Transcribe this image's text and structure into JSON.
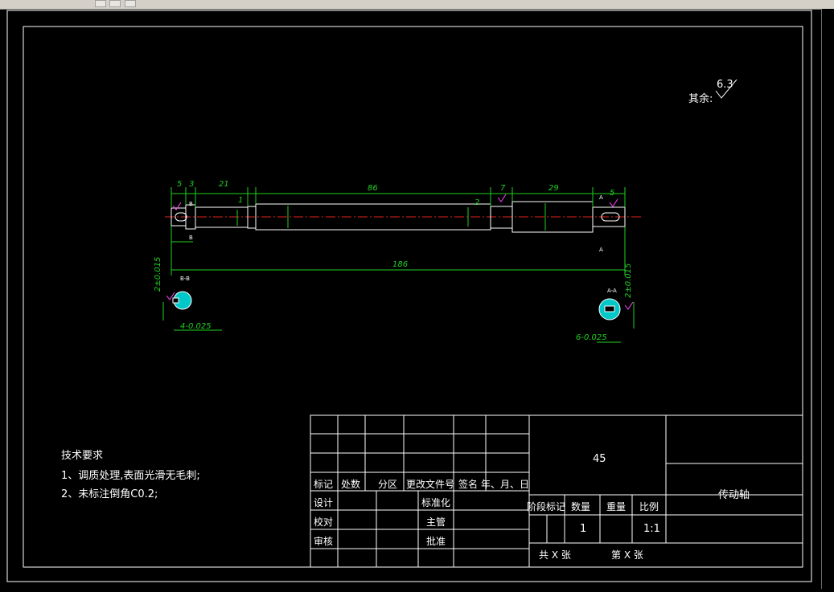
{
  "drawing": {
    "surface_roughness": {
      "label": "其余:",
      "value": "6.3"
    },
    "tech_requirements": {
      "title": "技术要求",
      "items": [
        "1、调质处理,表面光滑无毛刺;",
        "2、未标注倒角C0.2;"
      ]
    },
    "dimensions": {
      "top": [
        "5",
        "3",
        "21",
        "1",
        "86",
        "2",
        "7",
        "29",
        "5"
      ],
      "overall": "186",
      "section_b_label": "B-B",
      "section_a_label": "A-A",
      "section_b_width": "4-0.025",
      "section_a_width": "6-0.025",
      "section_b_height": "2±0.015",
      "section_a_height": "2±0.015",
      "marker_a": "A",
      "marker_b": "B"
    },
    "title_block": {
      "material": "45",
      "part_name": "传动轴",
      "header_row": [
        "标记",
        "处数",
        "分区",
        "更改文件号",
        "签名",
        "年、月、日"
      ],
      "left_rows": [
        "设计",
        "校对",
        "审核"
      ],
      "mid_rows": [
        "标准化",
        "主管",
        "批准"
      ],
      "stage_headers": [
        "阶段标记",
        "数量",
        "重量",
        "比例"
      ],
      "quantity": "1",
      "scale": "1:1",
      "sheets_total": "共 X 张",
      "sheet_no": "第 X 张"
    }
  },
  "colors": {
    "background": "#000000",
    "lines": "#ffffff",
    "dimension": "#20d020",
    "centerline": "#e02020",
    "hatch": "#00c8c8",
    "roughness": "#ff40ff"
  }
}
